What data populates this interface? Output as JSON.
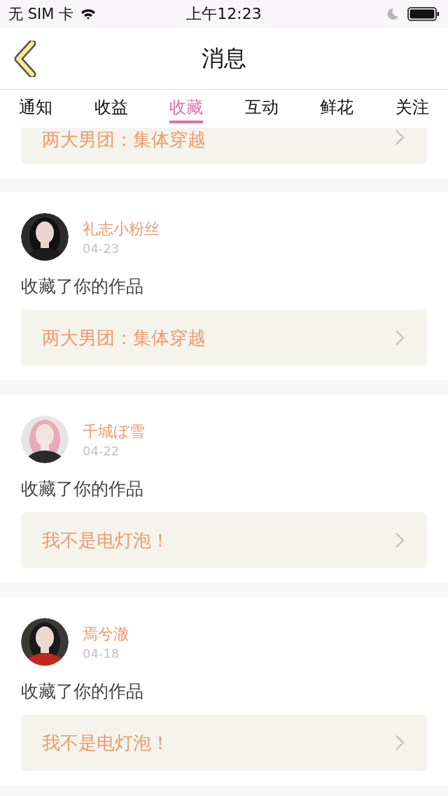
{
  "status_bar": {
    "carrier": "无 SIM 卡",
    "time": "上午12:23"
  },
  "nav": {
    "title": "消息"
  },
  "tabs": [
    {
      "label": "通知",
      "selected": false
    },
    {
      "label": "收益",
      "selected": false
    },
    {
      "label": "收藏",
      "selected": true
    },
    {
      "label": "互动",
      "selected": false
    },
    {
      "label": "鲜花",
      "selected": false
    },
    {
      "label": "关注",
      "selected": false
    }
  ],
  "partial_item": {
    "work": "两大男团：集体穿越"
  },
  "items": [
    {
      "name": "礼志小粉丝",
      "date": "04-23",
      "action": "收藏了你的作品",
      "work": "两大男团：集体穿越"
    },
    {
      "name": "千城ぼ雪",
      "date": "04-22",
      "action": "收藏了你的作品",
      "work": "我不是电灯泡！"
    },
    {
      "name": "焉兮澈",
      "date": "04-18",
      "action": "收藏了你的作品",
      "work": "我不是电灯泡！"
    }
  ]
}
